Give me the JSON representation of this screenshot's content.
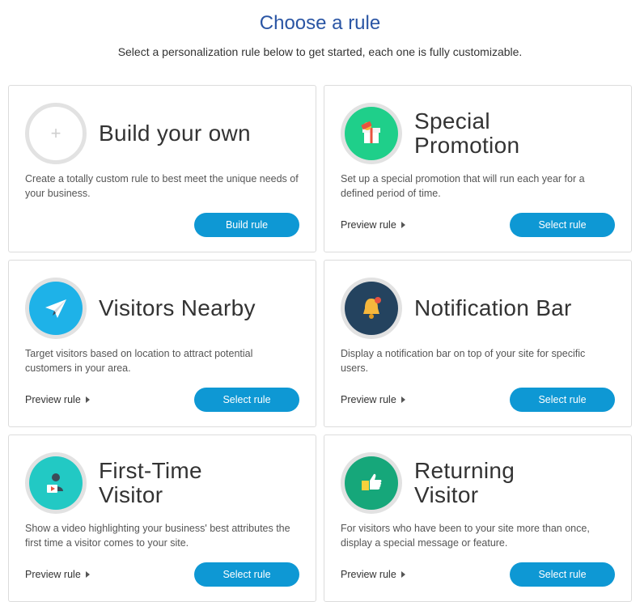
{
  "header": {
    "title": "Choose a rule",
    "subtitle": "Select a personalization rule below to get started, each one is fully customizable."
  },
  "cards": [
    {
      "title_line1": "Build your own",
      "title_line2": "",
      "description": "Create a totally custom rule to best meet the unique needs of your business.",
      "preview_label": "",
      "button_label": "Build rule",
      "icon": "plus-icon",
      "icon_color": "#e2e2e2"
    },
    {
      "title_line1": "Special",
      "title_line2": "Promotion",
      "description": "Set up a special promotion that will run each year for a defined period of time.",
      "preview_label": "Preview rule",
      "button_label": "Select rule",
      "icon": "gift-icon",
      "icon_color": "#1fcf8a"
    },
    {
      "title_line1": "Visitors Nearby",
      "title_line2": "",
      "description": "Target visitors based on location to attract potential customers in your area.",
      "preview_label": "Preview rule",
      "button_label": "Select rule",
      "icon": "paper-plane-icon",
      "icon_color": "#1eb2e8"
    },
    {
      "title_line1": "Notification Bar",
      "title_line2": "",
      "description": "Display a notification bar on top of your site for specific users.",
      "preview_label": "Preview rule",
      "button_label": "Select rule",
      "icon": "bell-icon",
      "icon_color": "#24435f"
    },
    {
      "title_line1": "First-Time",
      "title_line2": "Visitor",
      "description": "Show a video highlighting your business' best attributes the first time a visitor comes to your site.",
      "preview_label": "Preview rule",
      "button_label": "Select rule",
      "icon": "video-visitor-icon",
      "icon_color": "#22c9c4"
    },
    {
      "title_line1": "Returning",
      "title_line2": "Visitor",
      "description": "For visitors who have been to your site more than once, display a special message or feature.",
      "preview_label": "Preview rule",
      "button_label": "Select rule",
      "icon": "thumbs-up-icon",
      "icon_color": "#16a77a"
    }
  ],
  "colors": {
    "title": "#2a55a4",
    "button": "#0e98d4"
  }
}
